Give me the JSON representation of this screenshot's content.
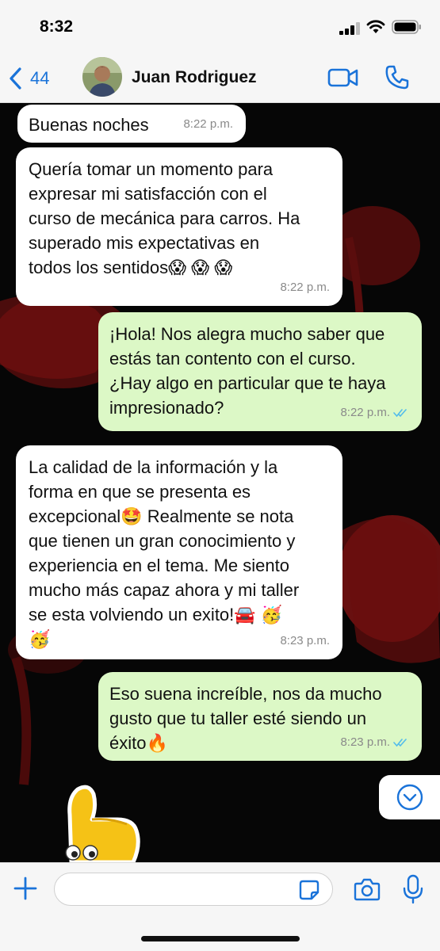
{
  "status_bar": {
    "time": "8:32"
  },
  "header": {
    "back_count": "44",
    "contact_name": "Juan Rodriguez"
  },
  "messages": [
    {
      "direction": "incoming",
      "text": "Buenas noches",
      "time": "8:22 p.m."
    },
    {
      "direction": "incoming",
      "text": "Quería tomar un momento para\nexpresar mi satisfacción con el\ncurso de mecánica para carros. Ha\nsuperado mis expectativas en\ntodos los sentidos😱 😱 😱",
      "time": "8:22 p.m."
    },
    {
      "direction": "outgoing",
      "text": "¡Hola! Nos alegra mucho saber que\nestás tan contento con el curso.\n¿Hay algo en particular que te haya\nimpresionado?",
      "time": "8:22 p.m.",
      "status": "read"
    },
    {
      "direction": "incoming",
      "text": "La calidad de la información y la\nforma en que se presenta es\nexcepcional🤩 Realmente se nota\nque  tienen un gran conocimiento y\nexperiencia en el tema. Me siento\nmucho más capaz ahora y mi taller\nse esta volviendo un exito!🚘 🥳\n🥳",
      "time": "8:23 p.m."
    },
    {
      "direction": "outgoing",
      "text": "Eso suena increíble, nos da mucho\ngusto que tu taller esté siendo un\néxito🔥",
      "time": "8:23 p.m.",
      "status": "read"
    }
  ],
  "input": {
    "placeholder": "",
    "value": ""
  },
  "colors": {
    "accent": "#1a73d9",
    "outgoing_bubble": "#dcf8c6",
    "incoming_bubble": "#ffffff",
    "read_ticks": "#53bdeb",
    "chat_background": "#060606"
  },
  "icons": [
    "back-chevron-icon",
    "video-call-icon",
    "phone-icon",
    "chevron-down-icon",
    "plus-icon",
    "sticker-icon",
    "camera-icon",
    "microphone-icon",
    "read-ticks-icon",
    "signal-icon",
    "wifi-icon",
    "battery-icon"
  ]
}
